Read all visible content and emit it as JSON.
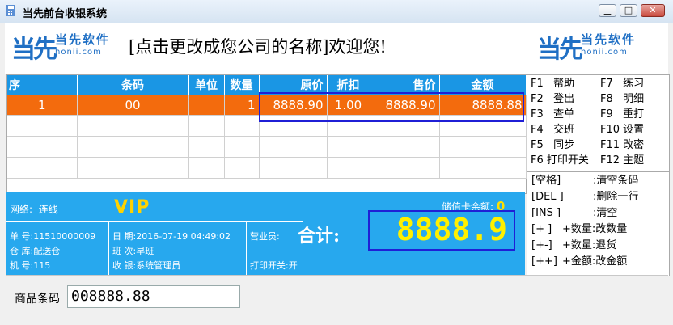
{
  "window": {
    "title": "当先前台收银系统",
    "btn_min": "▁",
    "btn_max": "□",
    "btn_close": "✕"
  },
  "header": {
    "logo_mark": "当先",
    "logo_text": "当先软件",
    "logo_domain": "honii.com",
    "welcome": "[点击更改成您公司的名称]欢迎您!"
  },
  "grid": {
    "columns": [
      "序",
      "条码",
      "单位",
      "数量",
      "原价",
      "折扣",
      "售价",
      "金额"
    ],
    "rows": [
      [
        "1",
        "00",
        "",
        "1",
        "8888.90",
        "1.00",
        "8888.90",
        "8888.88"
      ]
    ]
  },
  "fkeys": [
    {
      "key": "F1",
      "label": "帮助"
    },
    {
      "key": "F7",
      "label": "练习"
    },
    {
      "key": "F2",
      "label": "登出"
    },
    {
      "key": "F8",
      "label": "明细"
    },
    {
      "key": "F3",
      "label": "查单"
    },
    {
      "key": "F9",
      "label": "重打"
    },
    {
      "key": "F4",
      "label": "交班"
    },
    {
      "key": "F10",
      "label": "设置"
    },
    {
      "key": "F5",
      "label": "同步"
    },
    {
      "key": "F11",
      "label": "改密"
    },
    {
      "key": "F6",
      "label": "打印开关"
    },
    {
      "key": "F12",
      "label": "主题"
    }
  ],
  "shortcuts": [
    {
      "key": "[空格]",
      "desc": ":清空条码"
    },
    {
      "key": "[DEL ]",
      "desc": ":删除一行"
    },
    {
      "key": "[INS ]",
      "desc": ":清空"
    },
    {
      "key": "[+ ]",
      "desc": "+数量:改数量"
    },
    {
      "key": "[+-]",
      "desc": "+数量:退货"
    },
    {
      "key": "[++]",
      "desc": "+金额:改金额"
    }
  ],
  "info": {
    "network_label": "网络:",
    "network_value": "连线",
    "vip": "VIP",
    "stored_card_label": "储值卡余额:",
    "stored_card_value": "0",
    "order_no_label": "单  号:",
    "order_no_value": "11510000009",
    "warehouse_label": "仓  库:",
    "warehouse_value": "配送仓",
    "machine_label": "机  号:",
    "machine_value": "115",
    "date_label": "日  期:",
    "date_value": "2016-07-19 04:49:02",
    "shift_label": "班  次:",
    "shift_value": "早班",
    "cashier_label": "收  银:",
    "cashier_value": "系统管理员",
    "clerk_label": "营业员:",
    "print_label": "打印开关:",
    "print_value": "开",
    "total_label": "合计:",
    "total_value": "8888.9"
  },
  "bottom": {
    "barcode_label": "商品条码",
    "barcode_value": "008888.88"
  }
}
